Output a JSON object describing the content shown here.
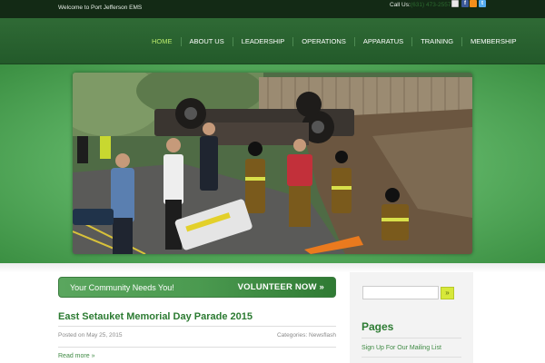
{
  "topbar": {
    "welcome": "Welcome to Port Jefferson EMS",
    "call_us": "Call Us:",
    "phone": "(631) 473-2557",
    "social_icons": [
      "mail-icon",
      "facebook-icon",
      "rss-icon",
      "twitter-icon"
    ]
  },
  "nav": {
    "items": [
      "HOME",
      "ABOUT US",
      "LEADERSHIP",
      "OPERATIONS",
      "APPARATUS",
      "TRAINING",
      "MEMBERSHIP"
    ],
    "active": "HOME"
  },
  "hero": {
    "image": "emergency-scene-photo"
  },
  "volunteer": {
    "left_text": "Your Community Needs You!",
    "right_text": "VOLUNTEER NOW »"
  },
  "post": {
    "title": "East Setauket Memorial Day Parade 2015",
    "posted": "Posted on May 25, 2015",
    "categories": "Categories: Newsflash",
    "read_more": "Read more »"
  },
  "sidebar": {
    "search_placeholder": "",
    "search_button": "»",
    "pages_title": "Pages",
    "pages": [
      "Sign Up For Our Mailing List"
    ]
  },
  "colors": {
    "topbar_bg": "#132a15",
    "header_bg": "#2a6330",
    "nav_active": "#b9ea6c",
    "link_green": "#3e8a43",
    "title_green": "#2c7b32",
    "search_button": "#d7e83a"
  }
}
